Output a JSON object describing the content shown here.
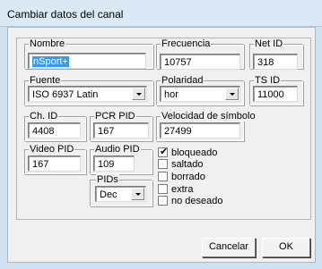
{
  "window": {
    "title": "Cambiar datos del canal"
  },
  "fields": {
    "nombre": {
      "label": "Nombre",
      "value": "nSport+"
    },
    "frecuencia": {
      "label": "Frecuencia",
      "value": "10757"
    },
    "net_id": {
      "label": "Net ID",
      "value": "318"
    },
    "fuente": {
      "label": "Fuente",
      "value": "ISO 6937 Latin"
    },
    "polaridad": {
      "label": "Polaridad",
      "value": "hor"
    },
    "ts_id": {
      "label": "TS ID",
      "value": "11000"
    },
    "ch_id": {
      "label": "Ch. ID",
      "value": "4408"
    },
    "pcr_pid": {
      "label": "PCR PID",
      "value": "167"
    },
    "velocidad": {
      "label": "Velocidad de símbolo",
      "value": "27499"
    },
    "video_pid": {
      "label": "Video PID",
      "value": "167"
    },
    "audio_pid": {
      "label": "Audio PID",
      "value": "109"
    },
    "pids": {
      "label": "PIDs",
      "value": "Dec"
    }
  },
  "flags": [
    {
      "label": "bloqueado",
      "checked": true
    },
    {
      "label": "saltado",
      "checked": false
    },
    {
      "label": "borrado",
      "checked": false
    },
    {
      "label": "extra",
      "checked": false
    },
    {
      "label": "no deseado",
      "checked": false
    }
  ],
  "buttons": {
    "cancel": "Cancelar",
    "ok": "OK"
  }
}
